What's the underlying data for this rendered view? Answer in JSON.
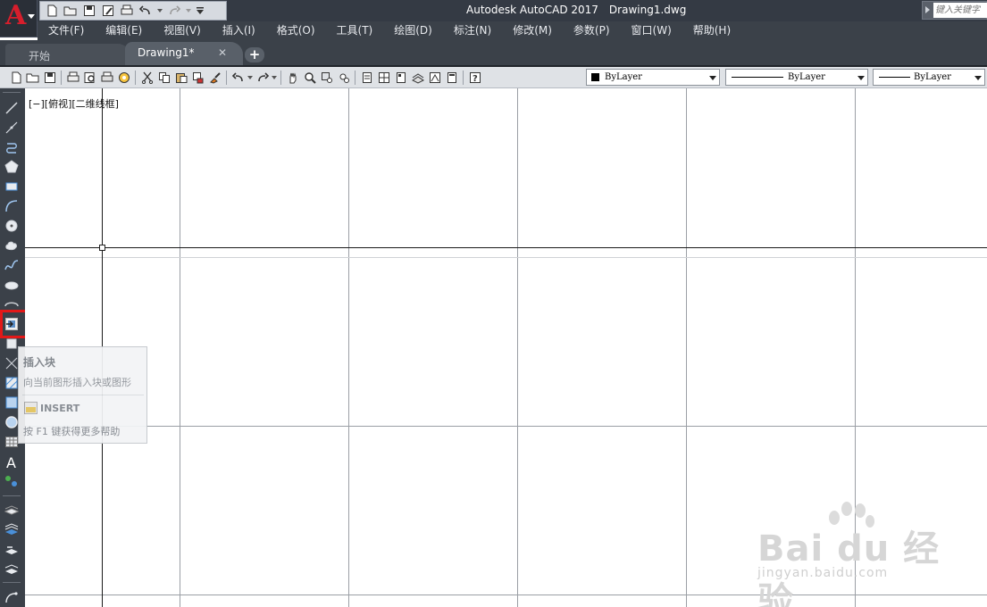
{
  "app": {
    "title": "Autodesk AutoCAD 2017",
    "document": "Drawing1.dwg",
    "logo_letter": "A"
  },
  "help_search": {
    "placeholder": "键入关键字"
  },
  "menubar": {
    "items": [
      "文件(F)",
      "编辑(E)",
      "视图(V)",
      "插入(I)",
      "格式(O)",
      "工具(T)",
      "绘图(D)",
      "标注(N)",
      "修改(M)",
      "参数(P)",
      "窗口(W)",
      "帮助(H)"
    ]
  },
  "tabs": {
    "start": "开始",
    "drawing": "Drawing1*",
    "close": "✕",
    "add": "+"
  },
  "properties": {
    "color": "ByLayer",
    "linetype": "ByLayer",
    "lineweight": "ByLayer"
  },
  "viewport": {
    "label": "[−][俯视][二维线框]"
  },
  "tooltip": {
    "title": "插入块",
    "description": "向当前图形插入块或图形",
    "command": "INSERT",
    "help": "按 F1 键获得更多帮助"
  },
  "watermark": {
    "brand": "Bai  du 经验",
    "url": "jingyan.baidu.com"
  },
  "colors": {
    "titlebar": "#343a44",
    "menubar": "#3b4149",
    "toolbar": "#dfe2e6",
    "highlight": "#e31818",
    "logo_red": "#d81e2c"
  }
}
